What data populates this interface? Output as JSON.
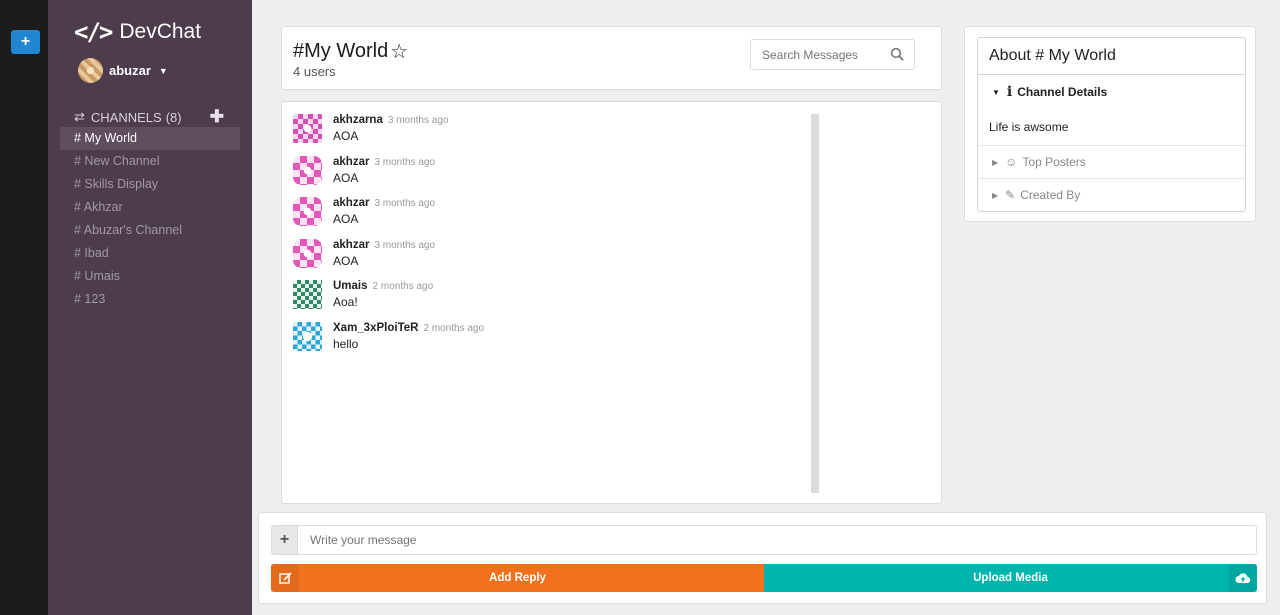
{
  "app": {
    "name": "DevChat"
  },
  "user": {
    "name": "abuzar"
  },
  "sidebar": {
    "channels_label": "CHANNELS",
    "channels_count": "(8)",
    "channels": [
      {
        "label": "# My World",
        "active": true
      },
      {
        "label": "# New Channel"
      },
      {
        "label": "# Skills Display"
      },
      {
        "label": "# Akhzar"
      },
      {
        "label": "# Abuzar's Channel"
      },
      {
        "label": "# Ibad"
      },
      {
        "label": "# Umais"
      },
      {
        "label": "# 123"
      }
    ]
  },
  "header": {
    "title": "#My World",
    "users": "4 users",
    "search_placeholder": "Search Messages"
  },
  "messages": [
    {
      "author": "akhzarna",
      "time": "3 months ago",
      "text": "AOA",
      "avatar": "pink-identicon"
    },
    {
      "author": "akhzar",
      "time": "3 months ago",
      "text": "AOA",
      "avatar": "pink-identicon"
    },
    {
      "author": "akhzar",
      "time": "3 months ago",
      "text": "AOA",
      "avatar": "pink-identicon"
    },
    {
      "author": "akhzar",
      "time": "3 months ago",
      "text": "AOA",
      "avatar": "pink-identicon"
    },
    {
      "author": "Umais",
      "time": "2 months ago",
      "text": "Aoa!",
      "avatar": "green-identicon"
    },
    {
      "author": "Xam_3xPloiTeR",
      "time": "2 months ago",
      "text": "hello",
      "avatar": "blue-identicon"
    }
  ],
  "about": {
    "title": "About # My World",
    "sections": {
      "details": "Channel Details",
      "description": "Life is awsome",
      "posters": "Top Posters",
      "created": "Created By"
    }
  },
  "compose": {
    "placeholder": "Write your message",
    "reply_label": "Add Reply",
    "upload_label": "Upload Media"
  },
  "colors": {
    "sidebar": "#4c3c4c",
    "strip": "#1b1c1d",
    "reply": "#f2711c",
    "upload": "#00b5ad",
    "add_button": "#2185d0"
  }
}
